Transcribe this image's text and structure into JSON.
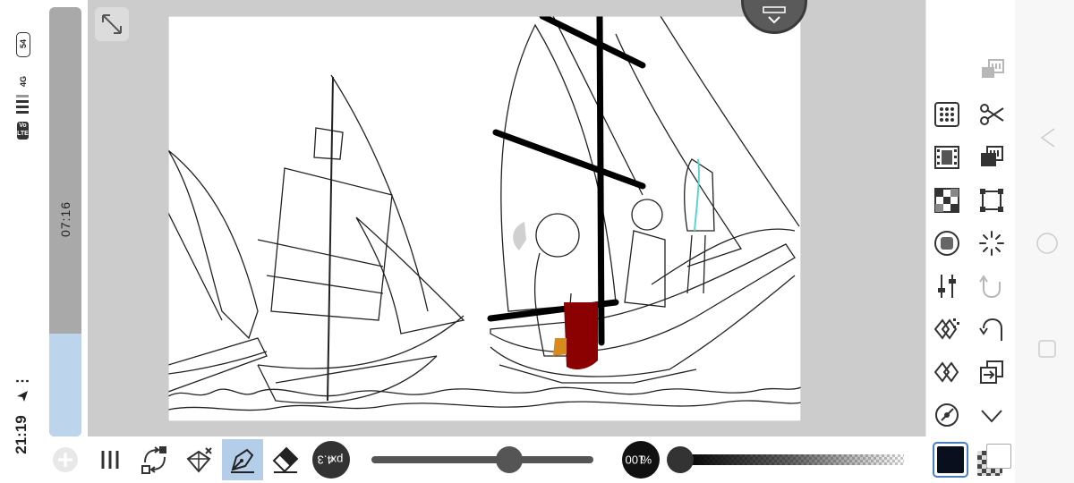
{
  "status_bar": {
    "time": "21:19",
    "battery": "54",
    "network": "4G",
    "volte": "Vo LTE",
    "more": "⋮"
  },
  "timer": {
    "elapsed": "07:16",
    "progress_fraction": 0.24
  },
  "brush": {
    "size_label": "4.3",
    "size_unit": "px",
    "size_slider_fraction": 0.62,
    "opacity_label": "100",
    "opacity_unit": "%",
    "opacity_slider_fraction": 0.0
  },
  "colors": {
    "foreground": "#0a0f1e",
    "background": "#ffffff",
    "accent": "#b4cde8"
  },
  "toolbar_left_icons": [
    "add-icon",
    "menu-icon",
    "transform-icon",
    "fill-icon",
    "pen-icon",
    "eraser-icon"
  ],
  "panel_icons": {
    "column_a": [
      "palette-grid-icon",
      "filmstrip-icon",
      "layer-grid-icon",
      "gradient-icon",
      "adjust-sliders-icon",
      "pattern-icon",
      "blend-icon",
      "compass-icon"
    ],
    "column_b": [
      "paste-icon",
      "cut-icon",
      "layers-icon",
      "select-rect-icon",
      "loading-icon",
      "redo-icon",
      "undo-icon",
      "import-icon",
      "collapse-icon"
    ]
  }
}
